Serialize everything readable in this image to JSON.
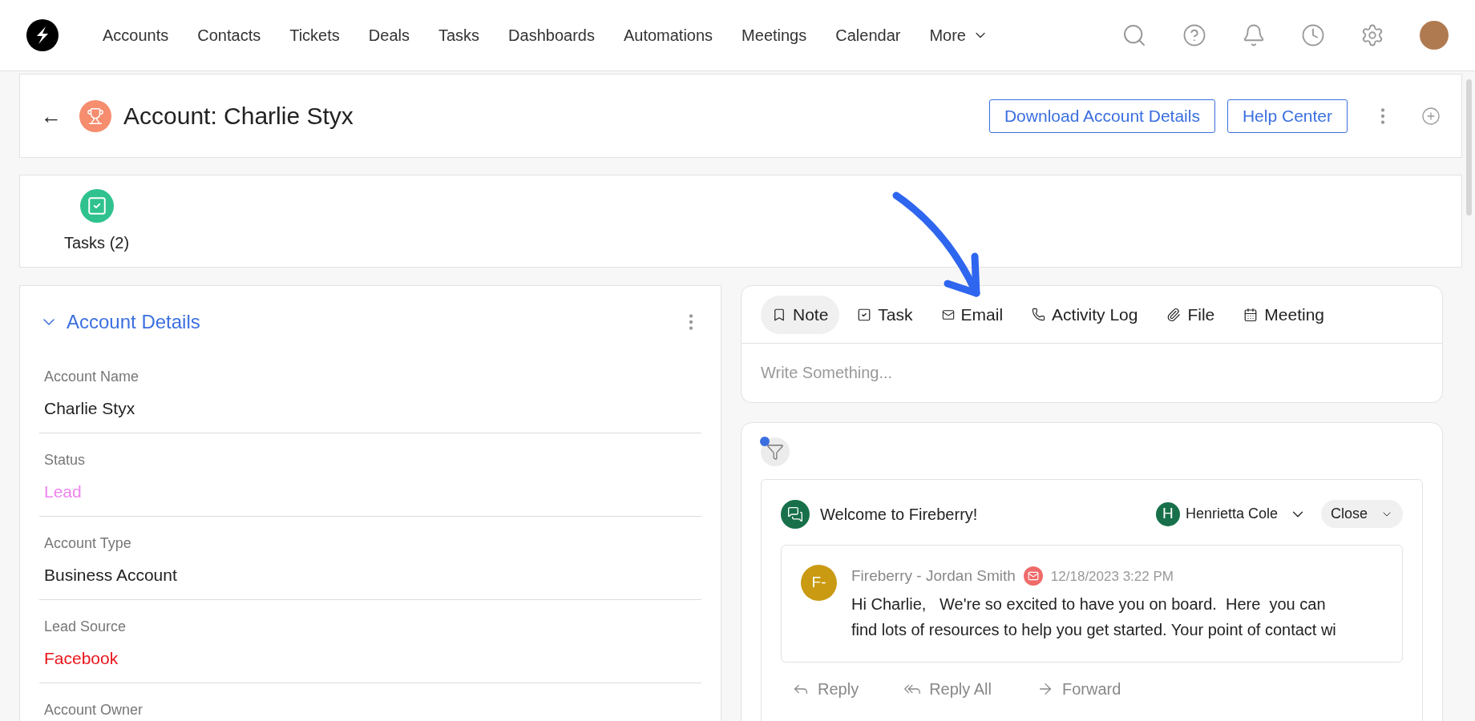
{
  "nav": {
    "items": [
      {
        "label": "Accounts"
      },
      {
        "label": "Contacts"
      },
      {
        "label": "Tickets"
      },
      {
        "label": "Deals"
      },
      {
        "label": "Tasks"
      },
      {
        "label": "Dashboards"
      },
      {
        "label": "Automations"
      },
      {
        "label": "Meetings"
      },
      {
        "label": "Calendar"
      }
    ],
    "more": "More"
  },
  "header": {
    "back": "←",
    "title": "Account: Charlie Styx",
    "buttons": [
      "Download Account Details",
      "Help Center"
    ]
  },
  "related": [
    {
      "label": "Tasks (2)"
    }
  ],
  "details": {
    "title": "Account Details",
    "expanded": true,
    "fields": [
      {
        "label": "Account Name",
        "value": "Charlie Styx",
        "color": "#222222"
      },
      {
        "label": "Status",
        "value": "Lead",
        "color": "#ee82ee"
      },
      {
        "label": "Account Type",
        "value": "Business Account",
        "color": "#222222"
      },
      {
        "label": "Lead Source",
        "value": "Facebook",
        "color": "#e8141b"
      },
      {
        "label": "Account Owner"
      }
    ]
  },
  "composer": {
    "tabs": [
      {
        "kind": "note",
        "label": "Note",
        "selected": true
      },
      {
        "kind": "task",
        "label": "Task",
        "selected": false
      },
      {
        "kind": "email",
        "label": "Email",
        "selected": false
      },
      {
        "kind": "call",
        "label": "Activity Log",
        "selected": false
      },
      {
        "kind": "file",
        "label": "File",
        "selected": false
      },
      {
        "kind": "meeting",
        "label": "Meeting",
        "selected": false
      }
    ],
    "placeholder": "Write Something..."
  },
  "feed": {
    "filter_active": true,
    "thread": {
      "subject": "Welcome to Fireberry!",
      "assignee_initial": "H",
      "assignee": "Henrietta Cole",
      "status": "Close",
      "message": {
        "avatar": "F-",
        "sender": "Fireberry - Jordan Smith",
        "time": "12/18/2023 3:22 PM",
        "body_lines": [
          "Hi Charlie,   We're so excited to have you on board.  Here  you can",
          "find lots of resources to help you get started. Your point of contact wi"
        ]
      },
      "actions": [
        {
          "kind": "reply",
          "label": "Reply"
        },
        {
          "kind": "reply_all",
          "label": "Reply All"
        },
        {
          "kind": "forward",
          "label": "Forward"
        }
      ]
    }
  }
}
